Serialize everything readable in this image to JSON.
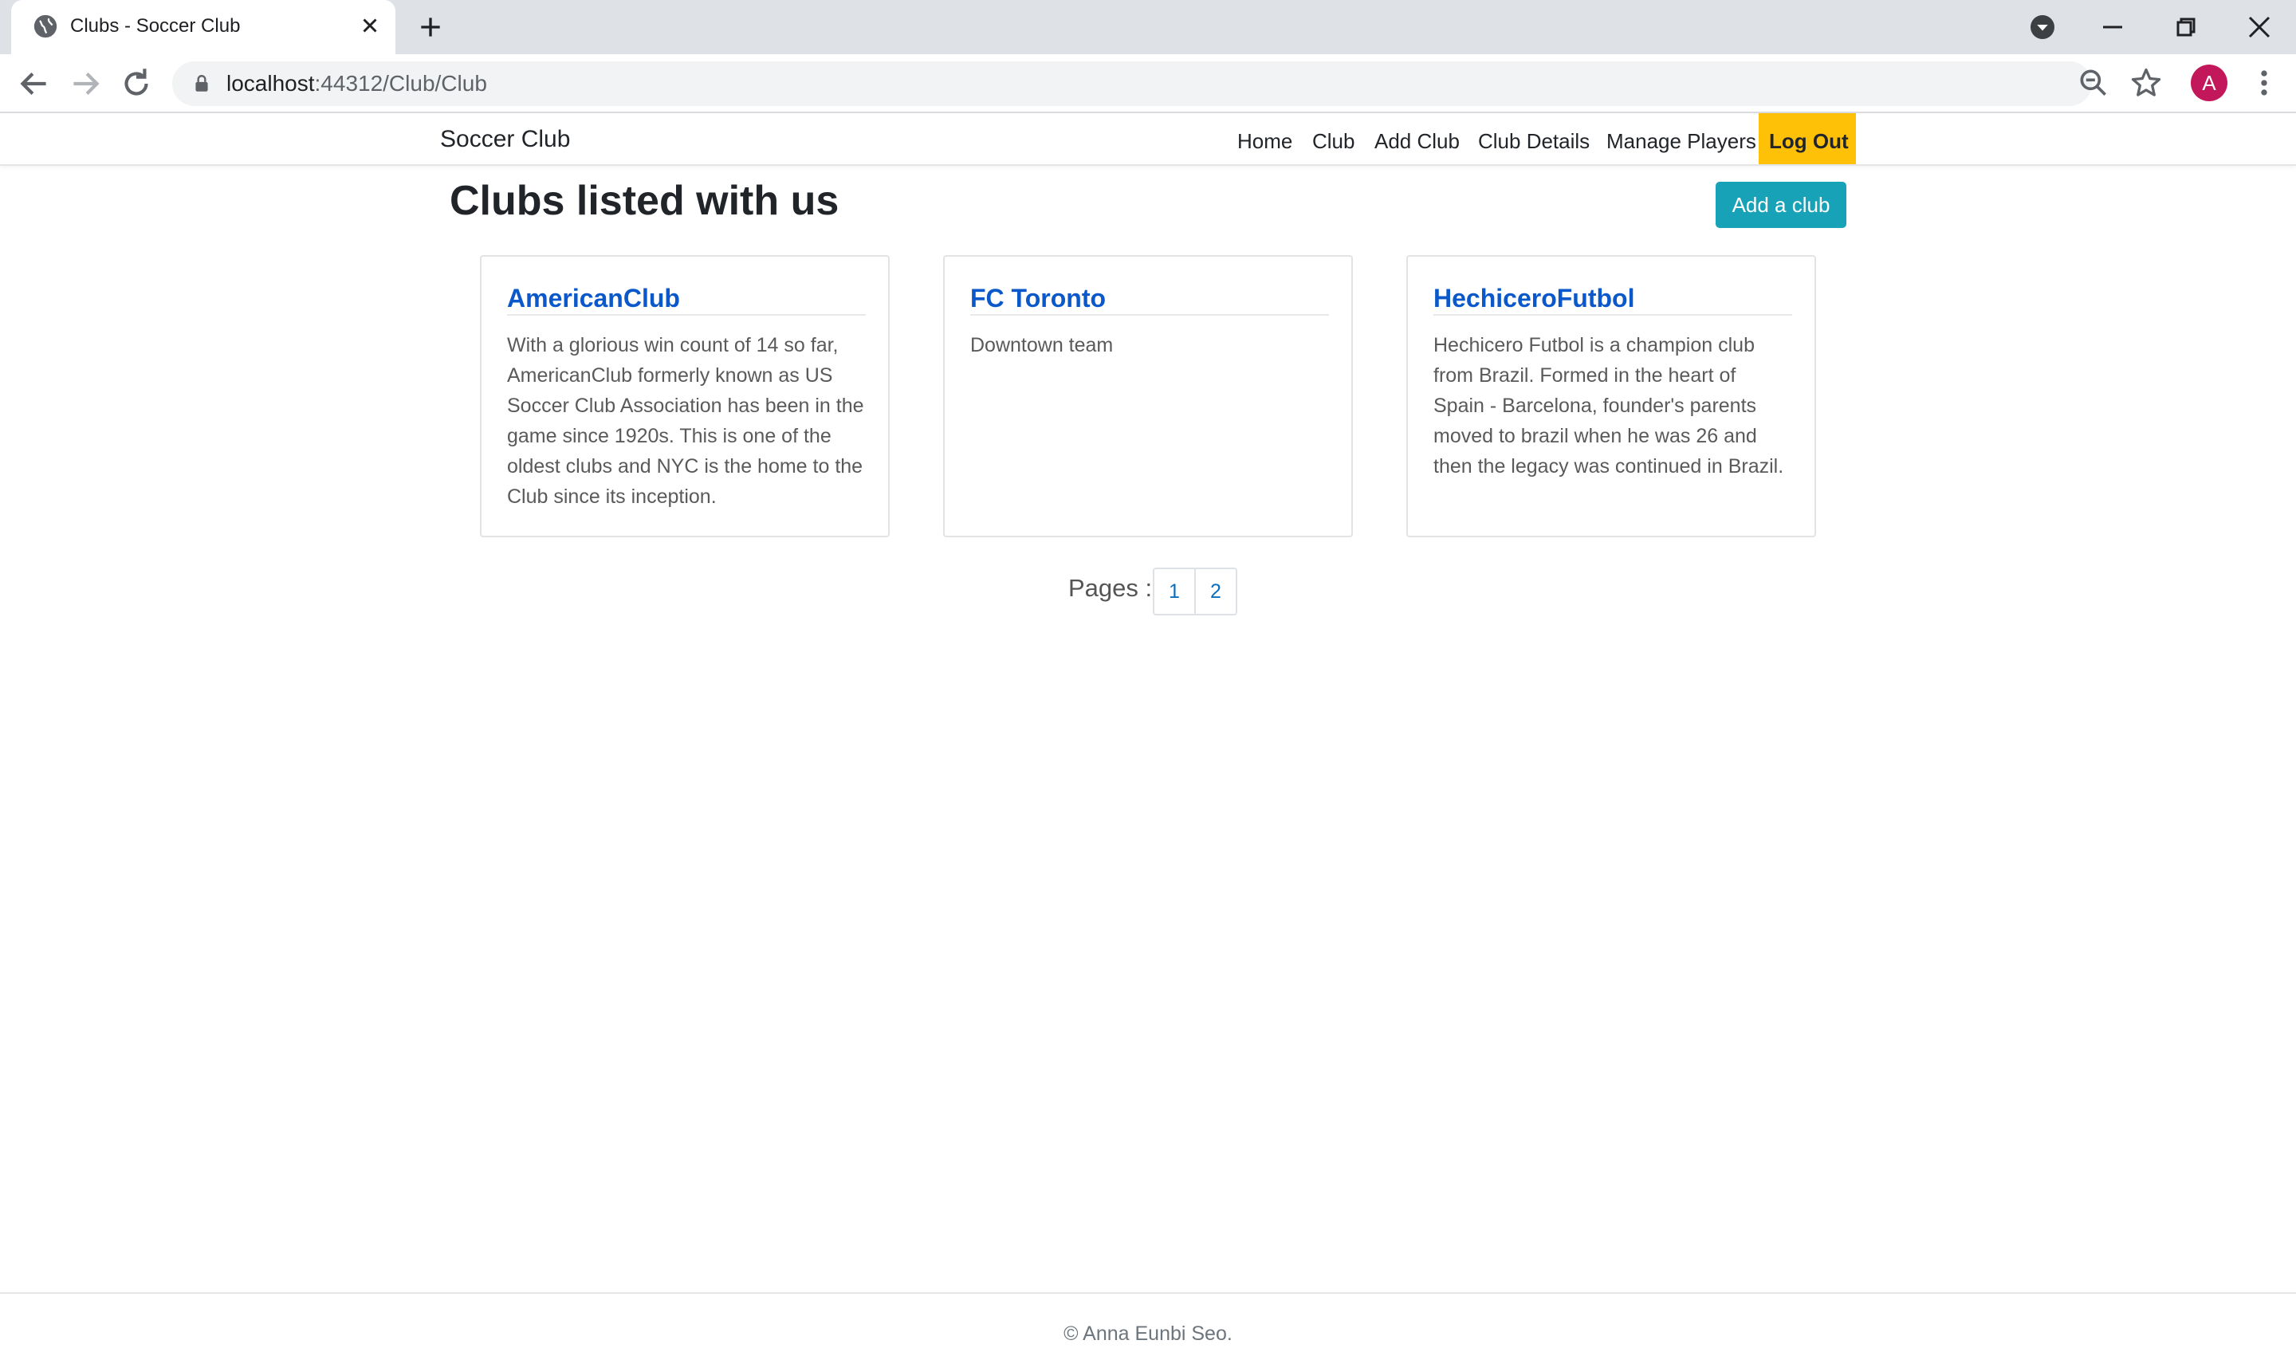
{
  "browser": {
    "tab_title": "Clubs - Soccer Club",
    "url_host": "localhost",
    "url_path": ":44312/Club/Club",
    "profile_initial": "A"
  },
  "navbar": {
    "brand": "Soccer Club",
    "links": [
      "Home",
      "Club",
      "Add Club",
      "Club Details",
      "Manage Players"
    ],
    "logout": "Log Out"
  },
  "main": {
    "title": "Clubs listed with us",
    "add_button": "Add a club",
    "clubs": [
      {
        "name": "AmericanClub",
        "description": "With a glorious win count of 14 so far, AmericanClub formerly known as US Soccer Club Association has been in the game since 1920s. This is one of the oldest clubs and NYC is the home to the Club since its inception."
      },
      {
        "name": "FC Toronto",
        "description": "Downtown team"
      },
      {
        "name": "HechiceroFutbol",
        "description": "Hechicero Futbol is a champion club from Brazil. Formed in the heart of Spain - Barcelona, founder's parents moved to brazil when he was 26 and then the legacy was continued in Brazil."
      }
    ],
    "pagination": {
      "label": "Pages :",
      "pages": [
        "1",
        "2"
      ]
    }
  },
  "footer": {
    "text": "© Anna Eunbi Seo."
  },
  "colors": {
    "logout_bg": "#ffc107",
    "add_button_bg": "#17a2b8",
    "link": "#0a58ca",
    "avatar": "#c2185b"
  }
}
